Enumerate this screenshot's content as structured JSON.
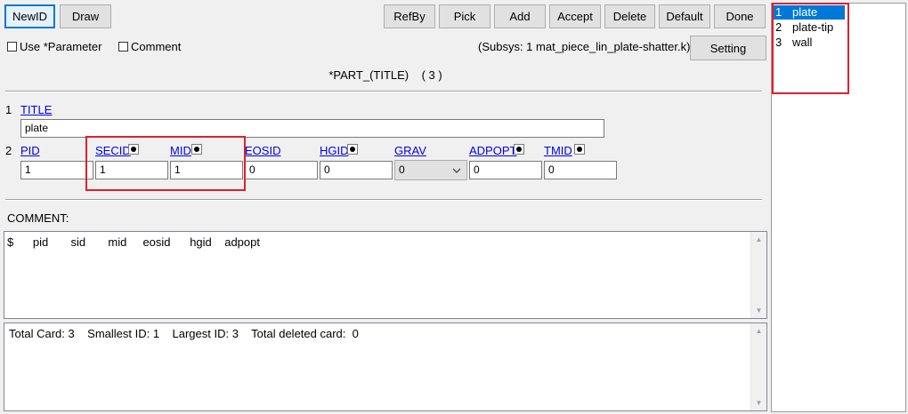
{
  "toolbar": {
    "newid": "NewID",
    "draw": "Draw",
    "refby": "RefBy",
    "pick": "Pick",
    "add": "Add",
    "accept": "Accept",
    "delete": "Delete",
    "default": "Default",
    "done": "Done"
  },
  "options": {
    "use_parameter": "Use *Parameter",
    "comment": "Comment",
    "subsys": "(Subsys: 1 mat_piece_lin_plate-shatter.k)",
    "setting": "Setting"
  },
  "card_title": "*PART_(TITLE)    ( 3 )",
  "row1": {
    "num": "1",
    "label": "TITLE",
    "value": "plate"
  },
  "row2": {
    "num": "2",
    "fields": [
      {
        "label": "PID",
        "value": "1"
      },
      {
        "label": "SECID",
        "value": "1"
      },
      {
        "label": "MID",
        "value": "1"
      },
      {
        "label": "EOSID",
        "value": "0"
      },
      {
        "label": "HGID",
        "value": "0"
      },
      {
        "label": "GRAV",
        "value": "0"
      },
      {
        "label": "ADPOPT",
        "value": "0"
      },
      {
        "label": "TMID",
        "value": "0"
      }
    ]
  },
  "comment": {
    "label": "COMMENT:",
    "text": "$      pid       sid       mid     eosid      hgid    adpopt"
  },
  "status": "Total Card: 3    Smallest ID: 1    Largest ID: 3    Total deleted card:  0",
  "list": [
    {
      "num": "1",
      "name": "plate"
    },
    {
      "num": "2",
      "name": "plate-tip"
    },
    {
      "num": "3",
      "name": "wall"
    }
  ],
  "colors": {
    "highlight": "#e0202c",
    "selection": "#0078d7"
  }
}
